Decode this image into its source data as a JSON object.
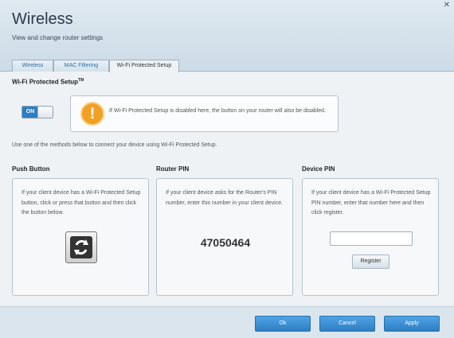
{
  "header": {
    "title": "Wireless",
    "subtitle": "View and change router settings",
    "close_glyph": "✕"
  },
  "tabs": [
    {
      "label": "Wireless",
      "active": false
    },
    {
      "label": "MAC Filtering",
      "active": false
    },
    {
      "label": "Wi-Fi Protected Setup",
      "active": true
    }
  ],
  "wps": {
    "title": "Wi-Fi Protected Setup",
    "title_sup": "TM",
    "toggle_label": "ON",
    "toggle_state": true,
    "alert_text": "If Wi-Fi Protected Setup is disabled here, the button on your router will also be disabled.",
    "alert_icon": "warning-icon",
    "alert_glyph": "!",
    "instruction": "Use one of the methods below to connect your device using Wi-Fi Protected Setup."
  },
  "push_button": {
    "title": "Push Button",
    "text": "If your client device has a Wi-Fi Protected Setup button, click or press that button and then click the button below.",
    "icon": "wps-sync-icon"
  },
  "router_pin": {
    "title": "Router PIN",
    "text": "If your client device asks for the Router's PIN number, enter this number in your client device.",
    "pin": "47050464"
  },
  "device_pin": {
    "title": "Device PIN",
    "text": "If your client device has a Wi-Fi Protected Setup PIN number, enter that number here and then click register.",
    "input_value": "",
    "register_label": "Register"
  },
  "footer": {
    "ok_label": "Ok",
    "cancel_label": "Cancel",
    "apply_label": "Apply"
  },
  "colors": {
    "accent": "#2d7fc1",
    "warning": "#f2a024",
    "background": "#eef2f5"
  }
}
